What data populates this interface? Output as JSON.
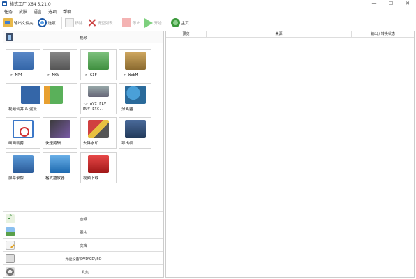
{
  "window": {
    "title": "格式工厂 X64 5.21.0",
    "controls": [
      "—",
      "☐",
      "✕"
    ]
  },
  "menu": [
    "任务",
    "皮肤",
    "语言",
    "选项",
    "帮助"
  ],
  "toolbar": {
    "output_folder": "输出文件夹",
    "options": "选项",
    "remove": "移除",
    "clear_list": "清空列表",
    "stop": "停止",
    "start": "开始",
    "home": "主页"
  },
  "left_panel": {
    "category_title": "视频",
    "tiles": [
      {
        "label": "-> MP4",
        "mono": true,
        "art": "MP4"
      },
      {
        "label": "-> MKV",
        "mono": true,
        "art": "MKV"
      },
      {
        "label": "-> GIF",
        "mono": true,
        "art": "GIF"
      },
      {
        "label": "-> WebM",
        "mono": true,
        "art": "WebM"
      },
      {
        "label": "视频合并 & 混流",
        "mono": false,
        "art": ""
      },
      {
        "label": "-> AVI FLV\nMOV Etc...",
        "mono": true,
        "art": ""
      },
      {
        "label": "分离器",
        "mono": false,
        "art": ""
      },
      {
        "label": "画面裁剪",
        "mono": false,
        "art": ""
      },
      {
        "label": "快速剪辑",
        "mono": false,
        "art": ""
      },
      {
        "label": "去除水印",
        "mono": false,
        "art": "Logo"
      },
      {
        "label": "导出帧",
        "mono": false,
        "art": ""
      },
      {
        "label": "屏幕录像",
        "mono": false,
        "art": ""
      },
      {
        "label": "格式播放器",
        "mono": false,
        "art": ""
      },
      {
        "label": "视频下载",
        "mono": false,
        "art": ""
      }
    ],
    "bottom_categories": [
      "音频",
      "图片",
      "文档",
      "光驱设备\\DVD\\CD\\ISO",
      "工具集"
    ]
  },
  "queue": {
    "columns": [
      "预览",
      "来源",
      "输出 / 转换状态"
    ]
  }
}
